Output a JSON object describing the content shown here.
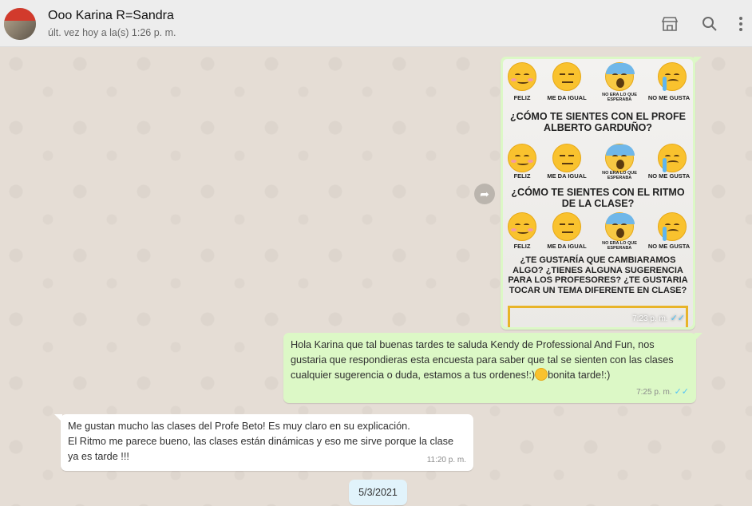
{
  "contact": {
    "name": "Ooo Karina R=Sandra",
    "status": "últ. vez hoy a la(s) 1:26 p. m."
  },
  "header_icons": [
    "store-icon",
    "search-icon",
    "menu-icon"
  ],
  "image_message": {
    "poll": {
      "row1_labels": [
        "FELIZ",
        "ME DA IGUAL",
        "NO ERA LO QUE ESPERABA",
        "NO ME GUSTA"
      ],
      "question1": "¿CÓMO TE SIENTES CON EL PROFE ALBERTO GARDUÑO?",
      "row2_labels": [
        "FELIZ",
        "ME DA IGUAL",
        "NO ERA LO QUE ESPERABA",
        "NO ME GUSTA"
      ],
      "question2": "¿CÓMO TE SIENTES CON EL RITMO DE LA CLASE?",
      "row3_labels": [
        "FELIZ",
        "ME DA IGUAL",
        "NO ERA LO QUE ESPERABA",
        "NO ME GUSTA"
      ],
      "question3": "¿TE GUSTARÍA QUE CAMBIARAMOS ALGO? ¿TIENES ALGUNA SUGERENCIA PARA LOS PROFESORES? ¿TE GUSTARIA TOCAR UN TEMA DIFERENTE EN CLASE?"
    },
    "time": "7:23 p. m.",
    "ticks": "✓✓"
  },
  "messages": [
    {
      "text": "Hola Karina que tal buenas tardes te saluda Kendy de Professional And Fun, nos gustaria que respondieras esta encuesta para saber que tal se sienten con las clases cualquier sugerencia o duda, estamos a tus ordenes!:)",
      "text_after_emoji": "bonita tarde!:)",
      "time": "7:25 p. m.",
      "ticks": "✓✓"
    },
    {
      "text": "Me gustan mucho las clases del Profe Beto! Es muy claro en su explicación.\nEl Ritmo me parece bueno, las clases están dinámicas y eso me sirve porque la clase ya es tarde !!!",
      "time": "11:20 p. m."
    }
  ],
  "date_chip": "5/3/2021",
  "colors": {
    "outgoing": "#dcf8c6",
    "incoming": "#ffffff",
    "header": "#ededed",
    "chat_bg": "#e5ddd5",
    "ticks": "#4fc3f7"
  }
}
